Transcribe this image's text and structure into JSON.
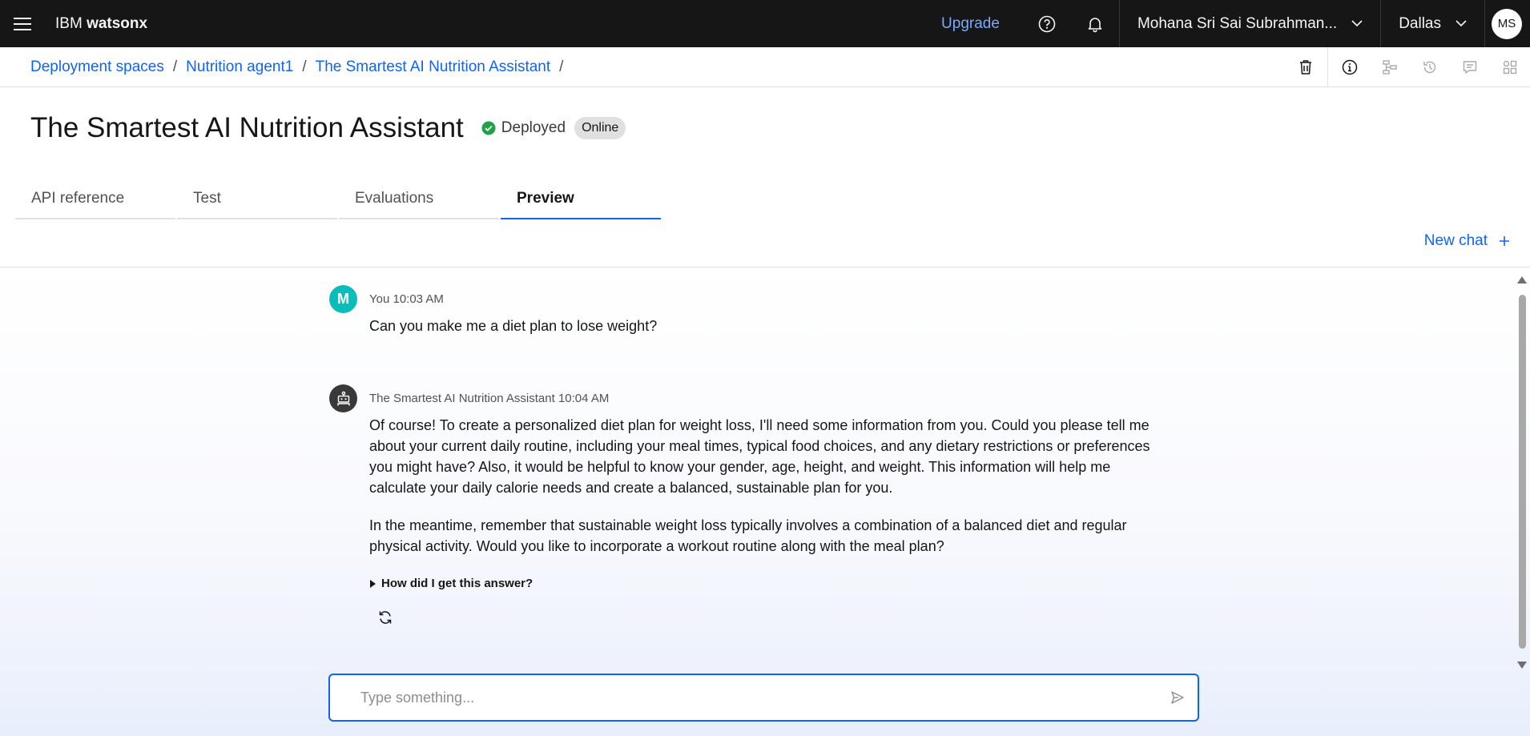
{
  "topbar": {
    "brand_prefix": "IBM",
    "brand_name": "watsonx",
    "upgrade": "Upgrade",
    "account": "Mohana Sri Sai Subrahman...",
    "region": "Dallas",
    "avatar_initials": "MS"
  },
  "breadcrumb": {
    "items": [
      "Deployment spaces",
      "Nutrition agent1",
      "The Smartest AI Nutrition Assistant"
    ],
    "separator": "/"
  },
  "header": {
    "title": "The Smartest AI Nutrition Assistant",
    "status": "Deployed",
    "tag": "Online"
  },
  "tabs": [
    "API reference",
    "Test",
    "Evaluations",
    "Preview"
  ],
  "active_tab": "Preview",
  "new_chat": "New chat",
  "messages": [
    {
      "author": "You",
      "time": "10:03 AM",
      "avatar": "M",
      "text": "Can you make me a diet plan to lose weight?"
    },
    {
      "author": "The Smartest AI Nutrition Assistant",
      "time": "10:04 AM",
      "paragraphs": [
        "Of course! To create a personalized diet plan for weight loss, I'll need some information from you. Could you please tell me about your current daily routine, including your meal times, typical food choices, and any dietary restrictions or preferences you might have? Also, it would be helpful to know your gender, age, height, and weight. This information will help me calculate your daily calorie needs and create a balanced, sustainable plan for you.",
        "In the meantime, remember that sustainable weight loss typically involves a combination of a balanced diet and regular physical activity. Would you like to incorporate a workout routine along with the meal plan?"
      ],
      "explain": "How did I get this answer?"
    }
  ],
  "input": {
    "placeholder": "Type something..."
  },
  "colors": {
    "accent": "#0f62fe",
    "user_avatar": "#08bdba",
    "success": "#24a148",
    "topbar": "#161616"
  }
}
